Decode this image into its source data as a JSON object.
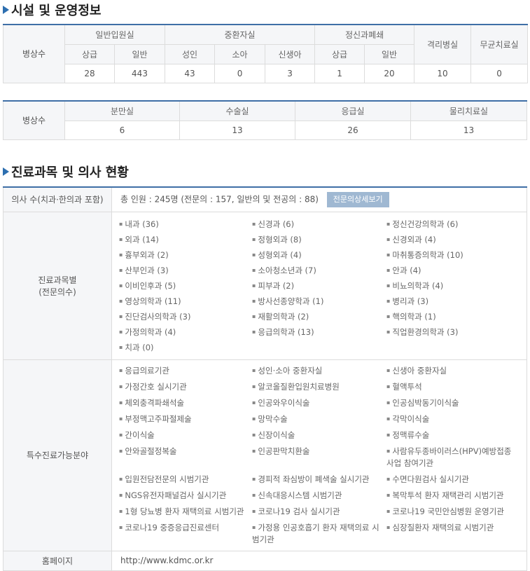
{
  "sections": {
    "facilities_title": "시설 및 운영정보",
    "doctors_title": "진료과목 및 의사 현황"
  },
  "beds": {
    "row_label": "병상수",
    "groups": [
      "일반입원실",
      "중환자실",
      "정신과폐쇄",
      "격리병실",
      "무균치료실"
    ],
    "sub": [
      "상급",
      "일반",
      "성인",
      "소아",
      "신생아",
      "상급",
      "일반"
    ],
    "values": [
      "28",
      "443",
      "43",
      "0",
      "3",
      "1",
      "20",
      "10",
      "0"
    ]
  },
  "rooms": {
    "row_label": "병상수",
    "headers": [
      "분만실",
      "수술실",
      "응급실",
      "물리치료실"
    ],
    "values": [
      "6",
      "13",
      "26",
      "13"
    ]
  },
  "doctors": {
    "count_label": "의사 수(치과·한의과 포함)",
    "count_text": "총 인원 : 245명 (전문의 : 157, 일반의 및 전공의 : 88)",
    "detail_button": "전문의상세보기",
    "departments_label_1": "진료과목별",
    "departments_label_2": "(전문의수)",
    "departments": [
      "내과 (36)",
      "신경과 (6)",
      "정신건강의학과 (6)",
      "외과 (14)",
      "정형외과 (8)",
      "신경외과 (4)",
      "흉부외과 (2)",
      "성형외과 (4)",
      "마취통증의학과 (10)",
      "산부인과 (3)",
      "소아청소년과 (7)",
      "안과 (4)",
      "이비인후과 (5)",
      "피부과 (2)",
      "비뇨의학과 (4)",
      "영상의학과 (11)",
      "방사선종양학과 (1)",
      "병리과 (3)",
      "진단검사의학과 (3)",
      "재활의학과 (2)",
      "핵의학과 (1)",
      "가정의학과 (4)",
      "응급의학과 (13)",
      "직업환경의학과 (3)",
      "치과 (0)"
    ],
    "special_label": "특수진료가능분야",
    "special": [
      "응급의료기관",
      "성인·소아 중환자실",
      "신생아 중환자실",
      "가정간호 실시기관",
      "알코올질환입원치료병원",
      "혈액투석",
      "체외충격파쇄석술",
      "인공와우이식술",
      "인공심박동기이식술",
      "부정맥고주파절제술",
      "망막수술",
      "각막이식술",
      "간이식술",
      "신장이식술",
      "정맥류수술",
      "안와골절정복술",
      "인공판막치환술",
      "사람유두종바이러스(HPV)예방접종사업 참여기관",
      "입원전담전문의 시범기관",
      "경피적 좌심방이 폐색술 실시기관",
      "수면다원검사 실시기관",
      "NGS유전자패널검사 실시기관",
      "신속대응시스템 시범기관",
      "복막투석 환자 재택관리 시범기관",
      "1형 당뇨병 환자 재택의료 시범기관",
      "코로나19 검사 실시기관",
      "코로나19 국민안심병원 운영기관",
      "코로나19 중증응급진료센터",
      "가정용 인공호흡기 환자 재택의료 시범기관",
      "심장질환자 재택의료 시범기관"
    ],
    "homepage_label": "홈페이지",
    "homepage_url": "http://www.kdmc.or.kr"
  },
  "colors": {
    "accent": "#3f6fa6",
    "button": "#9fb8d2",
    "header_bg": "#f5f6f8"
  }
}
